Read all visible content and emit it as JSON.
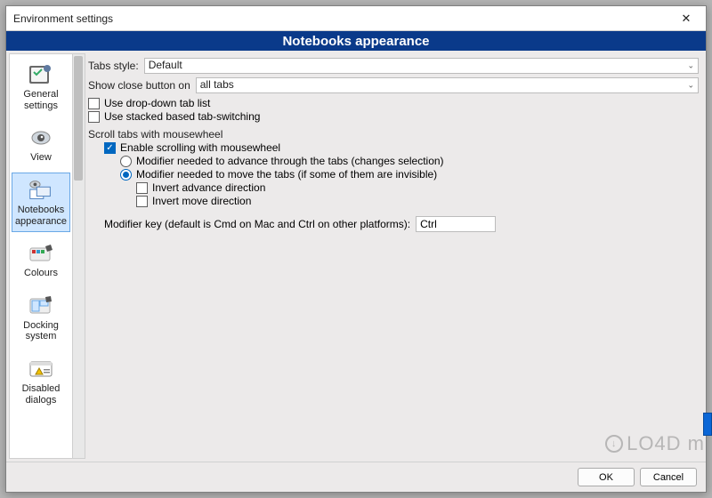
{
  "window": {
    "title": "Environment settings",
    "banner": "Notebooks appearance"
  },
  "sidebar": {
    "items": [
      {
        "label": "General\nsettings"
      },
      {
        "label": "View"
      },
      {
        "label": "Notebooks\nappearance",
        "selected": true
      },
      {
        "label": "Colours"
      },
      {
        "label": "Docking\nsystem"
      },
      {
        "label": "Disabled\ndialogs"
      }
    ]
  },
  "content": {
    "tabs_style_label": "Tabs style:",
    "tabs_style_value": "Default",
    "close_btn_label": "Show close button on",
    "close_btn_value": "all tabs",
    "opt_dropdown": "Use drop-down tab list",
    "opt_stacked": "Use stacked based tab-switching",
    "group_scroll": "Scroll tabs with mousewheel",
    "opt_enable_scroll": "Enable scrolling with mousewheel",
    "radio_advance": "Modifier needed to advance through the tabs (changes selection)",
    "radio_move": "Modifier needed to move the tabs (if some of them are invisible)",
    "opt_invert_advance": "Invert advance direction",
    "opt_invert_move": "Invert move direction",
    "mod_label": "Modifier key (default is Cmd on Mac and Ctrl on other platforms):",
    "mod_value": "Ctrl"
  },
  "footer": {
    "ok": "OK",
    "cancel": "Cancel"
  },
  "watermark": "LO4D m"
}
